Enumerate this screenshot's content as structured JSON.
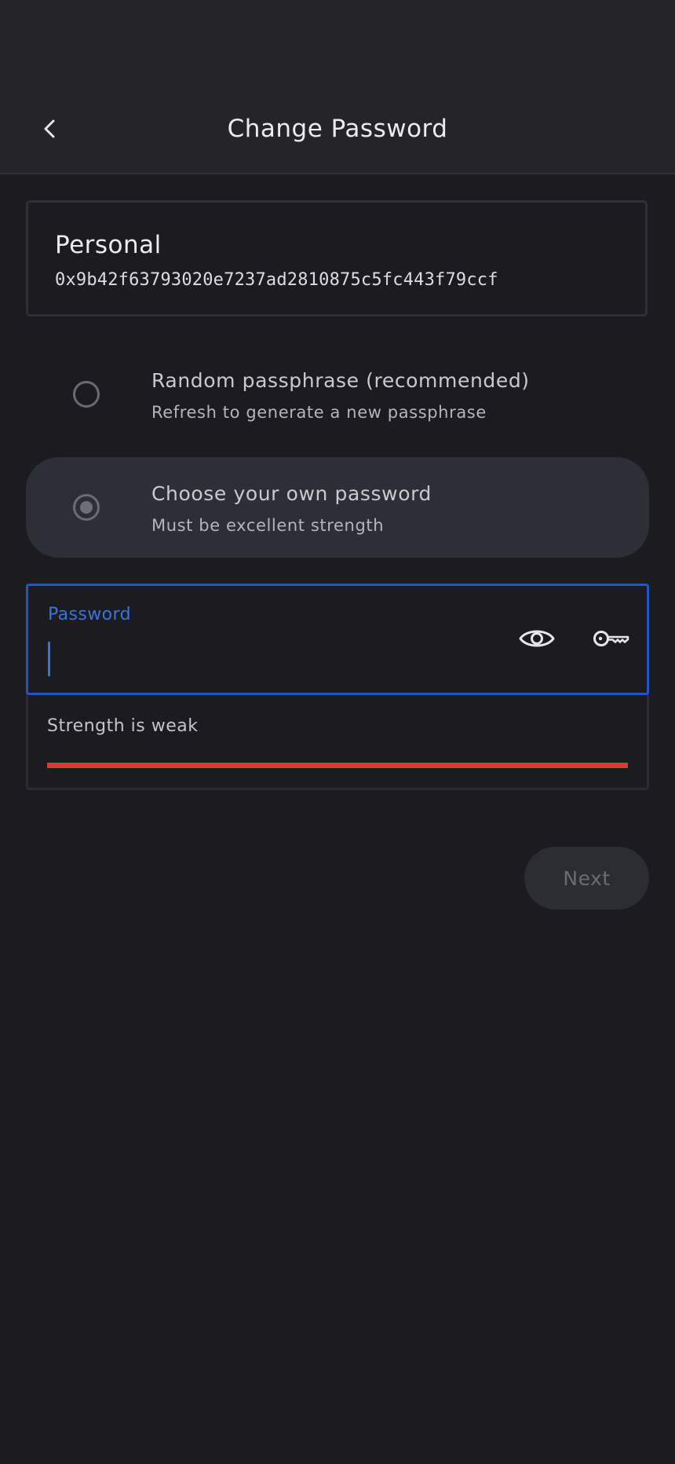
{
  "header": {
    "title": "Change Password",
    "back_icon": "chevron-left-icon"
  },
  "account": {
    "name": "Personal",
    "address": "0x9b42f63793020e7237ad2810875c5fc443f79ccf"
  },
  "options": [
    {
      "title": "Random passphrase (recommended)",
      "subtitle": "Refresh to generate a new passphrase",
      "selected": false
    },
    {
      "title": "Choose your own password",
      "subtitle": "Must be excellent strength",
      "selected": true
    }
  ],
  "password_field": {
    "label": "Password",
    "value": "",
    "visibility_icon": "eye-icon",
    "generate_icon": "key-icon"
  },
  "strength": {
    "text": "Strength is weak",
    "level": 1.0,
    "color": "#d93a34"
  },
  "next_button": {
    "label": "Next",
    "enabled": false
  },
  "colors": {
    "background": "#1c1c20",
    "header": "#252529",
    "accent": "#1f57c9",
    "selected_option": "#2d2f37"
  }
}
